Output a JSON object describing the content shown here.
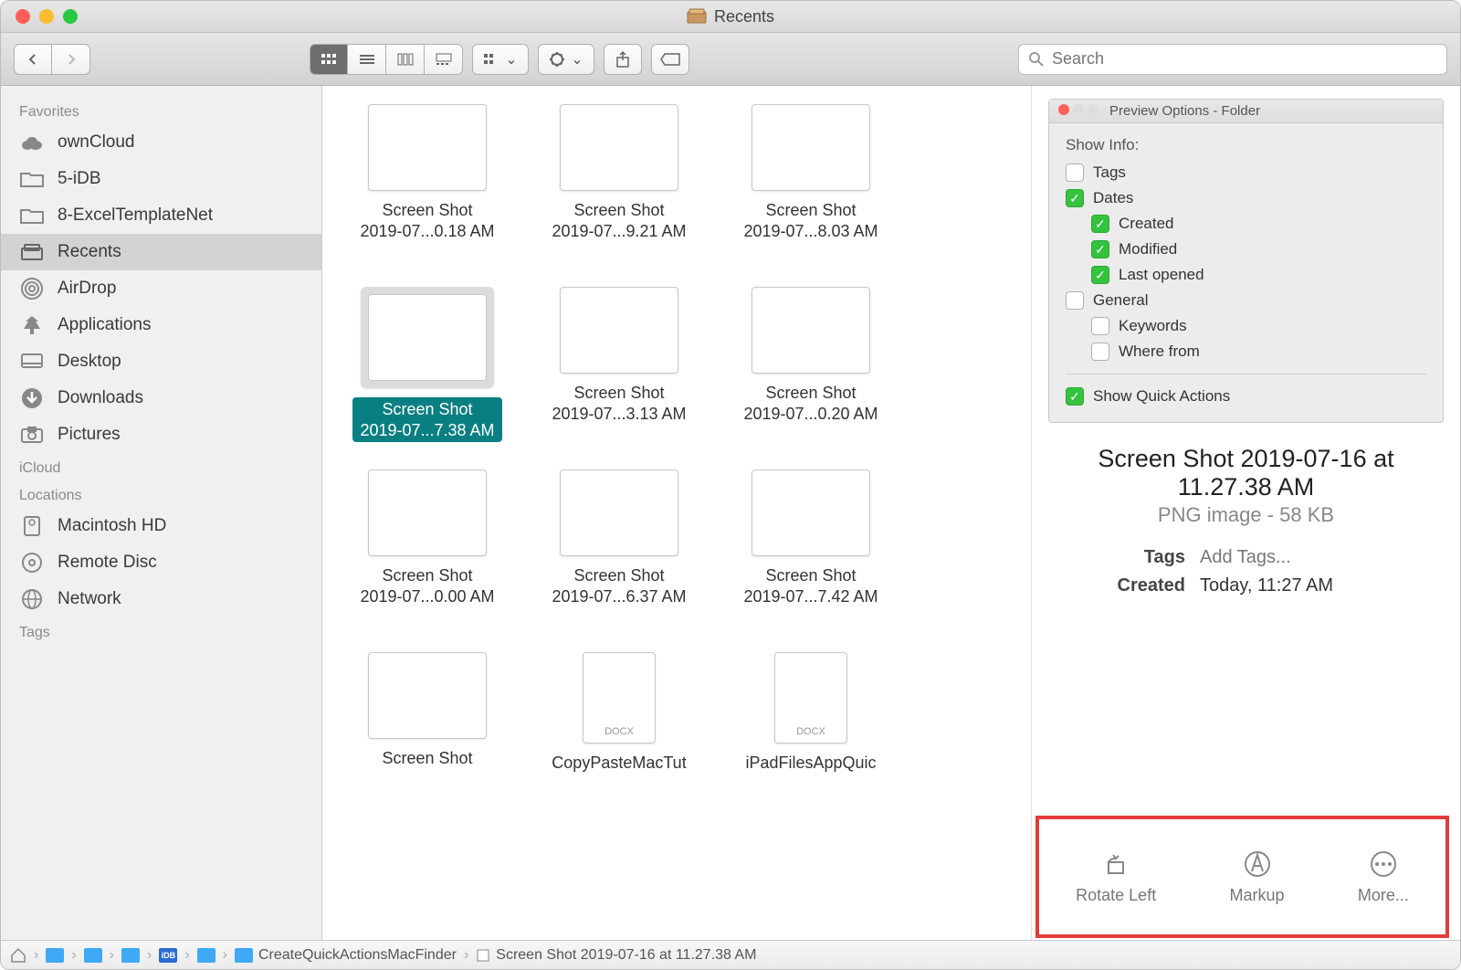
{
  "window": {
    "title": "Recents"
  },
  "search": {
    "placeholder": "Search"
  },
  "sidebar": {
    "sections": [
      {
        "header": "Favorites",
        "items": [
          {
            "label": "ownCloud",
            "icon": "cloud"
          },
          {
            "label": "5-iDB",
            "icon": "folder"
          },
          {
            "label": "8-ExcelTemplateNet",
            "icon": "folder"
          },
          {
            "label": "Recents",
            "icon": "recents",
            "selected": true
          },
          {
            "label": "AirDrop",
            "icon": "airdrop"
          },
          {
            "label": "Applications",
            "icon": "apps"
          },
          {
            "label": "Desktop",
            "icon": "desktop"
          },
          {
            "label": "Downloads",
            "icon": "downloads"
          },
          {
            "label": "Pictures",
            "icon": "pictures"
          }
        ]
      },
      {
        "header": "iCloud",
        "items": []
      },
      {
        "header": "Locations",
        "items": [
          {
            "label": "Macintosh HD",
            "icon": "hdd"
          },
          {
            "label": "Remote Disc",
            "icon": "disc"
          },
          {
            "label": "Network",
            "icon": "network"
          }
        ]
      },
      {
        "header": "Tags",
        "items": []
      }
    ]
  },
  "files": [
    {
      "line1": "Screen Shot",
      "line2": "2019-07...0.18 AM",
      "type": "png"
    },
    {
      "line1": "Screen Shot",
      "line2": "2019-07...9.21 AM",
      "type": "png"
    },
    {
      "line1": "Screen Shot",
      "line2": "2019-07...8.03 AM",
      "type": "png"
    },
    {
      "line1": "Screen Shot",
      "line2": "2019-07...7.38 AM",
      "type": "png",
      "selected": true
    },
    {
      "line1": "Screen Shot",
      "line2": "2019-07...3.13 AM",
      "type": "png"
    },
    {
      "line1": "Screen Shot",
      "line2": "2019-07...0.20 AM",
      "type": "png"
    },
    {
      "line1": "Screen Shot",
      "line2": "2019-07...0.00 AM",
      "type": "png"
    },
    {
      "line1": "Screen Shot",
      "line2": "2019-07...6.37 AM",
      "type": "png"
    },
    {
      "line1": "Screen Shot",
      "line2": "2019-07...7.42 AM",
      "type": "png"
    },
    {
      "line1": "Screen Shot",
      "line2": "",
      "type": "png"
    },
    {
      "line1": "CopyPasteMacTut",
      "line2": "",
      "type": "docx"
    },
    {
      "line1": "iPadFilesAppQuic",
      "line2": "",
      "type": "docx"
    }
  ],
  "preview_options": {
    "title": "Preview Options - Folder",
    "show_info_label": "Show Info:",
    "tags": {
      "label": "Tags",
      "checked": false
    },
    "dates": {
      "label": "Dates",
      "checked": true
    },
    "created": {
      "label": "Created",
      "checked": true
    },
    "modified": {
      "label": "Modified",
      "checked": true
    },
    "last_opened": {
      "label": "Last opened",
      "checked": true
    },
    "general": {
      "label": "General",
      "checked": false
    },
    "keywords": {
      "label": "Keywords",
      "checked": false
    },
    "where_from": {
      "label": "Where from",
      "checked": false
    },
    "show_quick": {
      "label": "Show Quick Actions",
      "checked": true
    }
  },
  "preview": {
    "title": "Screen Shot 2019-07-16 at 11.27.38 AM",
    "subtitle": "PNG image - 58 KB",
    "tags_label": "Tags",
    "tags_placeholder": "Add Tags...",
    "created_label": "Created",
    "created_value": "Today, 11:27 AM"
  },
  "quick_actions": {
    "rotate": "Rotate Left",
    "markup": "Markup",
    "more": "More..."
  },
  "pathbar": {
    "crumbs": [
      "",
      "",
      "",
      "",
      "iDB",
      "",
      "CreateQuickActionsMacFinder",
      "Screen Shot 2019-07-16 at 11.27.38 AM"
    ]
  }
}
